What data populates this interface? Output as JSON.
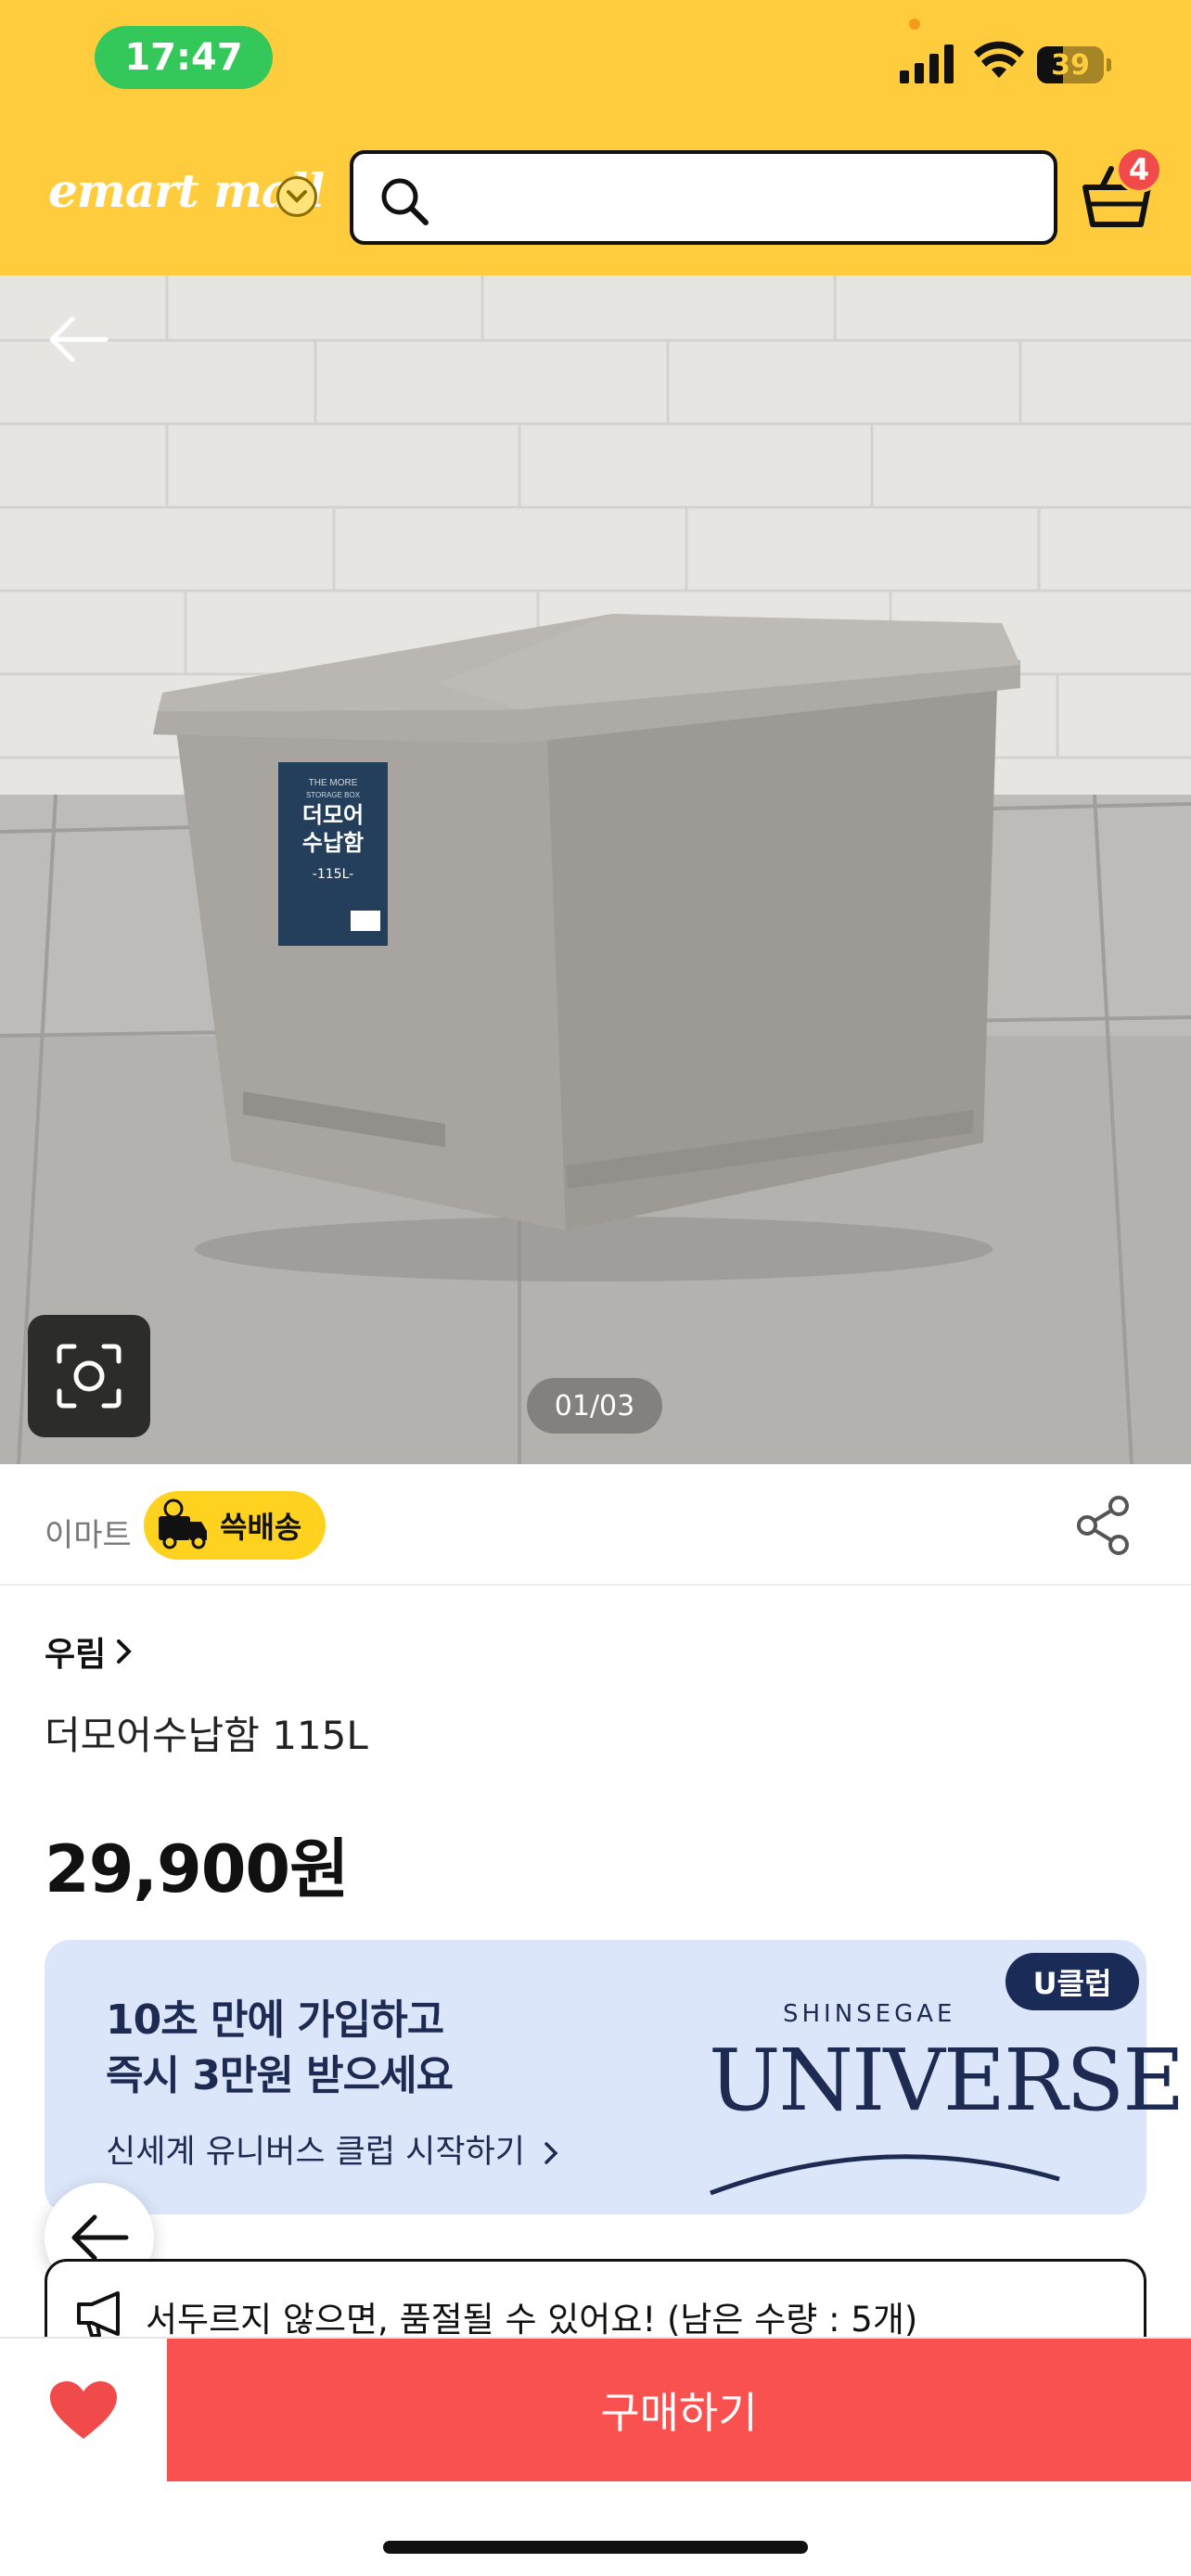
{
  "status_bar": {
    "time": "17:47",
    "battery": "39",
    "battery_level": 0.39
  },
  "header": {
    "logo_text": "emart mall",
    "search_placeholder": "",
    "cart_count": "4",
    "accent_color": "#FFCC3D"
  },
  "gallery": {
    "counter": "01/03"
  },
  "product_image": {
    "label_line1": "THE MORE",
    "label_line2": "STORAGE BOX",
    "label_title1": "더모어",
    "label_title2": "수납함",
    "label_size": "-115L-"
  },
  "seller": {
    "name": "이마트",
    "delivery_badge": "쓱배송"
  },
  "product": {
    "brand": "우림",
    "title": "더모어수납함 115L",
    "price": "29,900원"
  },
  "promo": {
    "line1": "10초 만에 가입하고",
    "line2": "즉시 3만원 받으세요",
    "link": "신세계 유니버스 클럽 시작하기",
    "badge": "U클럽",
    "brand_small": "SHINSEGAE",
    "brand_big": "UNIVERSE"
  },
  "notice": {
    "text": "서두르지 않으면, 품절될 수 있어요! (남은 수량 : 5개)"
  },
  "bottom_bar": {
    "buy_label": "구매하기",
    "wish_color": "#F04A4A",
    "buy_color": "#F9514F"
  },
  "icons": [
    "search-icon",
    "cart-icon",
    "chevron-down-icon",
    "back-arrow-icon",
    "lens-icon",
    "share-icon",
    "chevron-right-icon",
    "megaphone-icon",
    "heart-icon"
  ]
}
